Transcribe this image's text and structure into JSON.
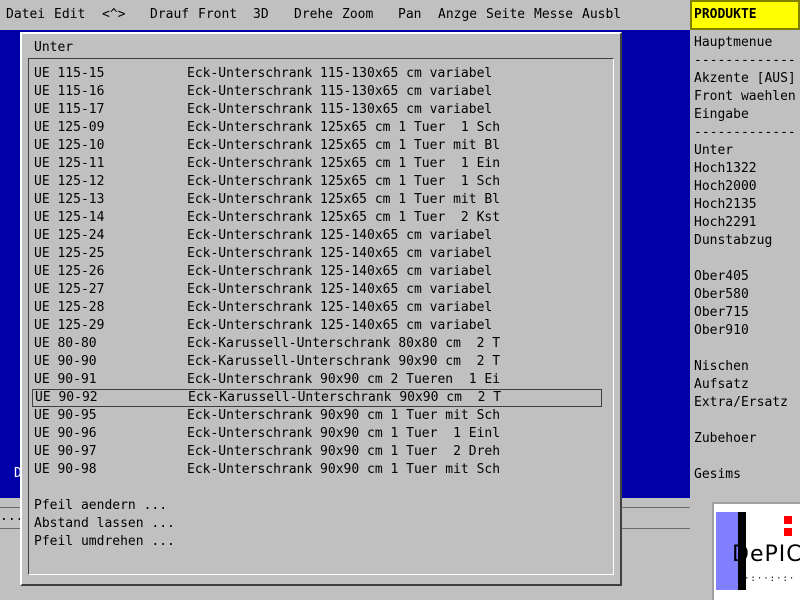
{
  "menubar": {
    "items": [
      "Datei",
      "Edit",
      "<^>",
      "Drauf",
      "Front",
      "3D",
      "Drehe",
      "Zoom",
      "Pan",
      "Anzge",
      "Seite",
      "Messe",
      "Ausbl"
    ]
  },
  "canvas": {
    "left_mark": "D"
  },
  "status": {
    "field": "..."
  },
  "dialog": {
    "title": "Unter",
    "rows": [
      {
        "code": "UE 115-15",
        "desc": "Eck-Unterschrank 115-130x65 cm variabel"
      },
      {
        "code": "UE 115-16",
        "desc": "Eck-Unterschrank 115-130x65 cm variabel"
      },
      {
        "code": "UE 115-17",
        "desc": "Eck-Unterschrank 115-130x65 cm variabel"
      },
      {
        "code": "UE 125-09",
        "desc": "Eck-Unterschrank 125x65 cm 1 Tuer  1 Sch"
      },
      {
        "code": "UE 125-10",
        "desc": "Eck-Unterschrank 125x65 cm 1 Tuer mit Bl"
      },
      {
        "code": "UE 125-11",
        "desc": "Eck-Unterschrank 125x65 cm 1 Tuer  1 Ein"
      },
      {
        "code": "UE 125-12",
        "desc": "Eck-Unterschrank 125x65 cm 1 Tuer  1 Sch"
      },
      {
        "code": "UE 125-13",
        "desc": "Eck-Unterschrank 125x65 cm 1 Tuer mit Bl"
      },
      {
        "code": "UE 125-14",
        "desc": "Eck-Unterschrank 125x65 cm 1 Tuer  2 Kst"
      },
      {
        "code": "UE 125-24",
        "desc": "Eck-Unterschrank 125-140x65 cm variabel"
      },
      {
        "code": "UE 125-25",
        "desc": "Eck-Unterschrank 125-140x65 cm variabel"
      },
      {
        "code": "UE 125-26",
        "desc": "Eck-Unterschrank 125-140x65 cm variabel"
      },
      {
        "code": "UE 125-27",
        "desc": "Eck-Unterschrank 125-140x65 cm variabel"
      },
      {
        "code": "UE 125-28",
        "desc": "Eck-Unterschrank 125-140x65 cm variabel"
      },
      {
        "code": "UE 125-29",
        "desc": "Eck-Unterschrank 125-140x65 cm variabel"
      },
      {
        "code": "UE 80-80",
        "desc": "Eck-Karussell-Unterschrank 80x80 cm  2 T"
      },
      {
        "code": "UE 90-90",
        "desc": "Eck-Karussell-Unterschrank 90x90 cm  2 T"
      },
      {
        "code": "UE 90-91",
        "desc": "Eck-Unterschrank 90x90 cm 2 Tueren  1 Ei"
      },
      {
        "code": "UE 90-92",
        "desc": "Eck-Karussell-Unterschrank 90x90 cm  2 T"
      },
      {
        "code": "UE 90-95",
        "desc": "Eck-Unterschrank 90x90 cm 1 Tuer mit Sch"
      },
      {
        "code": "UE 90-96",
        "desc": "Eck-Unterschrank 90x90 cm 1 Tuer  1 Einl"
      },
      {
        "code": "UE 90-97",
        "desc": "Eck-Unterschrank 90x90 cm 1 Tuer  2 Dreh"
      },
      {
        "code": "UE 90-98",
        "desc": "Eck-Unterschrank 90x90 cm 1 Tuer mit Sch"
      }
    ],
    "selected_code": "UE 90-92",
    "actions": [
      "Pfeil aendern ...",
      "Abstand lassen ...",
      "Pfeil umdrehen ..."
    ]
  },
  "sidepanel": {
    "title": "PRODUKTE",
    "items": [
      {
        "label": "Hauptmenue"
      },
      {
        "label": "--------------",
        "divider": true
      },
      {
        "label": "Akzente [AUS]"
      },
      {
        "label": "Front waehlen"
      },
      {
        "label": "Eingabe"
      },
      {
        "label": "--------------",
        "divider": true
      },
      {
        "label": "Unter"
      },
      {
        "label": "Hoch1322"
      },
      {
        "label": "Hoch2000"
      },
      {
        "label": "Hoch2135"
      },
      {
        "label": "Hoch2291"
      },
      {
        "label": "Dunstabzug"
      },
      {
        "label": "",
        "spacer": true
      },
      {
        "label": "Ober405"
      },
      {
        "label": "Ober580"
      },
      {
        "label": "Ober715"
      },
      {
        "label": "Ober910"
      },
      {
        "label": "",
        "spacer": true
      },
      {
        "label": "Nischen"
      },
      {
        "label": "Aufsatz"
      },
      {
        "label": "Extra/Ersatz"
      },
      {
        "label": "",
        "spacer": true
      },
      {
        "label": "Zubehoer"
      },
      {
        "label": "",
        "spacer": true
      },
      {
        "label": "Gesims"
      }
    ]
  },
  "logo": {
    "text": "DePICT",
    "dots": "·:··:·:·"
  },
  "colors": {
    "canvas": "#0000a8",
    "panel": "#c0c0c0",
    "title_highlight": "#ffff00",
    "logo_accent": "#ff0000",
    "logo_blue": "#8080ff"
  }
}
